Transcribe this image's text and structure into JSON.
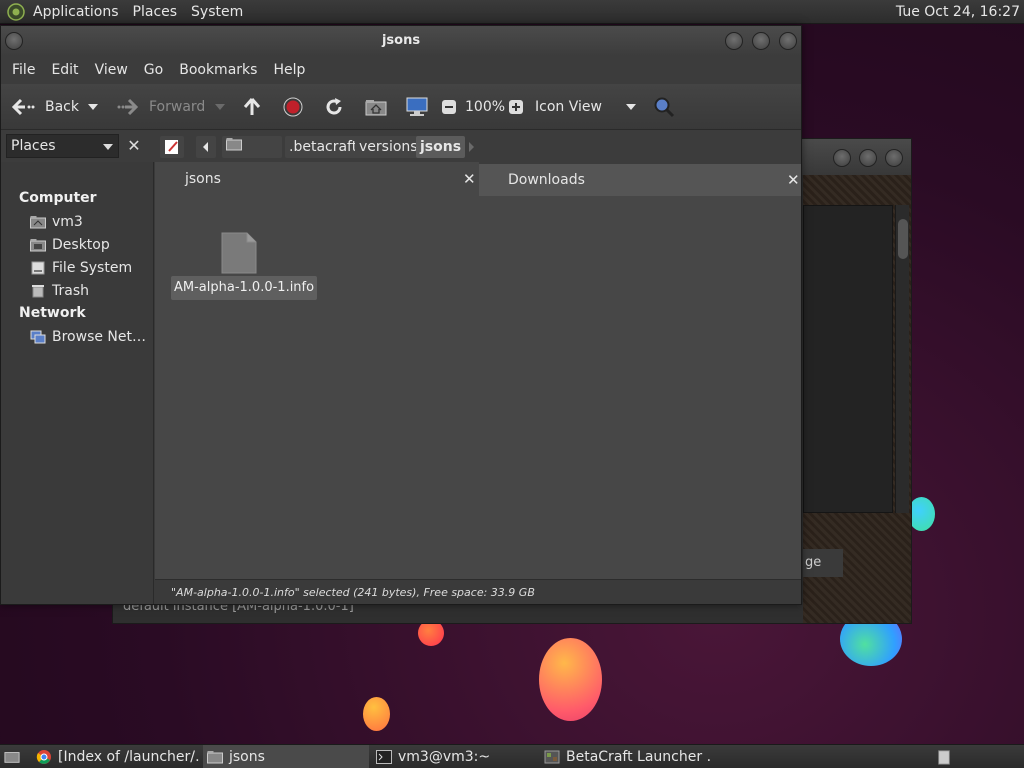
{
  "top_panel": {
    "menus": [
      "Applications",
      "Places",
      "System"
    ],
    "clock": "Tue Oct 24, 16:27"
  },
  "window": {
    "title": "jsons",
    "menus": [
      "File",
      "Edit",
      "View",
      "Go",
      "Bookmarks",
      "Help"
    ],
    "toolbar": {
      "back": "Back",
      "forward": "Forward",
      "zoom": "100%",
      "view_mode": "Icon View"
    },
    "location": {
      "places_label": "Places",
      "breadcrumbs": [
        "vm3",
        ".betacraft",
        "versions",
        "jsons"
      ]
    },
    "sidebar": {
      "computer_heading": "Computer",
      "computer_items": [
        "vm3",
        "Desktop",
        "File System",
        "Trash"
      ],
      "network_heading": "Network",
      "network_items": [
        "Browse Net…"
      ]
    },
    "tabs": [
      "jsons",
      "Downloads"
    ],
    "files": [
      {
        "name": "AM-alpha-1.0.0-1.info",
        "icon": "document-icon",
        "selected": true
      }
    ],
    "status": "\"AM-alpha-1.0.0-1.info\" selected (241 bytes), Free space: 33.9 GB"
  },
  "background_window": {
    "partial_button": "ge",
    "partial_text": "default instance [AM-alpha-1.0.0-1]"
  },
  "taskbar": {
    "tasks": [
      "[Index of /launcher/…",
      "jsons",
      "vm3@vm3:~",
      "BetaCraft Launcher …"
    ]
  },
  "colors": {
    "window_bg": "#3a3a3a",
    "content_bg": "#474747",
    "desktop_bg": "#2a0b24",
    "stop_red": "#c0202a"
  }
}
